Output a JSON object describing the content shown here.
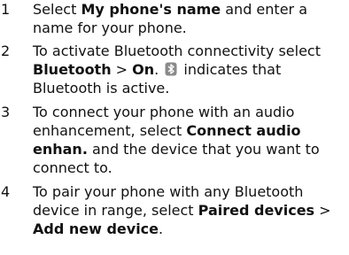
{
  "steps": [
    {
      "number": "1",
      "parts": [
        "Select ",
        "My phone's name",
        " and enter a name for your phone."
      ]
    },
    {
      "number": "2",
      "parts": [
        "To activate Bluetooth connectivity select ",
        "Bluetooth",
        " > ",
        "On",
        ". ",
        " indicates that Bluetooth is active."
      ],
      "icon": "bluetooth-icon"
    },
    {
      "number": "3",
      "parts": [
        "To connect your phone with an audio enhancement, select ",
        "Connect audio enhan.",
        " and the device that you want to connect to."
      ]
    },
    {
      "number": "4",
      "parts": [
        "To pair your phone with any Bluetooth device in range, select ",
        "Paired devices",
        " > ",
        "Add new device",
        "."
      ]
    }
  ],
  "colors": {
    "text": "#111111",
    "icon": "#8a8a8a"
  }
}
